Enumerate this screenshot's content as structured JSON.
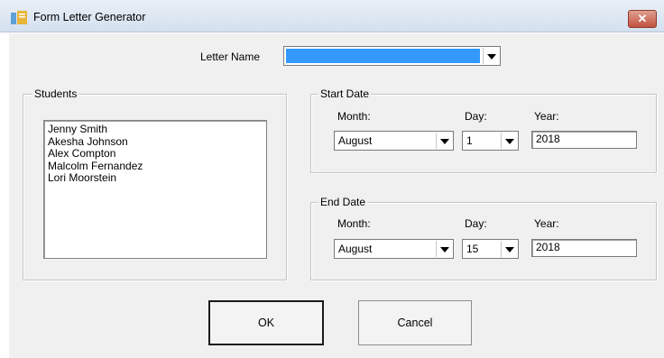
{
  "window": {
    "title": "Form Letter Generator",
    "close_label": "✕"
  },
  "letter": {
    "label": "Letter Name",
    "value": ""
  },
  "students": {
    "group_title": "Students",
    "items": [
      "Jenny Smith",
      "Akesha Johnson",
      "Alex Compton",
      "Malcolm Fernandez",
      "Lori Moorstein"
    ]
  },
  "start_date": {
    "group_title": "Start Date",
    "month_label": "Month:",
    "day_label": "Day:",
    "year_label": "Year:",
    "month": "August",
    "day": "1",
    "year": "2018"
  },
  "end_date": {
    "group_title": "End Date",
    "month_label": "Month:",
    "day_label": "Day:",
    "year_label": "Year:",
    "month": "August",
    "day": "15",
    "year": "2018"
  },
  "buttons": {
    "ok": "OK",
    "cancel": "Cancel"
  },
  "colors": {
    "selection": "#3399ff",
    "close": "#c1523f",
    "dialog_bg": "#f0f0f0"
  }
}
